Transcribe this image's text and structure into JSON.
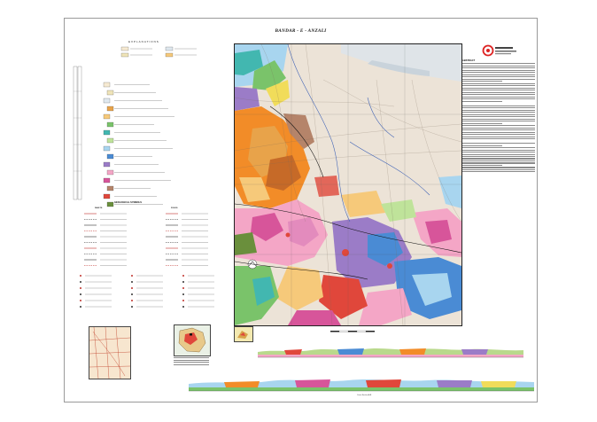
{
  "sheet": {
    "title": "BANDAR - E - ANZALI",
    "top_note": "",
    "explanations_label": "EXPLANATIONS",
    "geological_symbols_label": "GEOLOGICAL SYMBOLS",
    "faults_label": "FAULTS",
    "folds_label": "FOLDS",
    "about_label": "ABSTRACT",
    "cross_section_label": "Cross Section  A-B"
  },
  "colors": {
    "map_base": "#eee6dc",
    "orange": "#f28c28",
    "pink": "#f4a6c6",
    "magenta": "#d7559a",
    "green": "#7ac36a",
    "teal": "#42b7b0",
    "blue": "#4a8bd4",
    "yellow": "#f1dc5a",
    "purple": "#9b7cc7",
    "brown": "#b5846a",
    "red": "#e0473b",
    "lightblue": "#a8d5ef"
  },
  "legend_units": [
    {
      "code": "Qal",
      "color": "#f6ead2"
    },
    {
      "code": "Qt",
      "color": "#efe4b8"
    },
    {
      "code": "Qm",
      "color": "#dfe8ef"
    },
    {
      "code": "Plc",
      "color": "#e8a34a"
    },
    {
      "code": "Ng",
      "color": "#f6c97a"
    },
    {
      "code": "Ev",
      "color": "#7ac36a"
    },
    {
      "code": "Eb",
      "color": "#42b7b0"
    },
    {
      "code": "K",
      "color": "#bfe39a"
    },
    {
      "code": "Kl",
      "color": "#a8d5ef"
    },
    {
      "code": "J",
      "color": "#4a8bd4"
    },
    {
      "code": "Tr",
      "color": "#9b7cc7"
    },
    {
      "code": "P",
      "color": "#f4a6c6"
    },
    {
      "code": "C",
      "color": "#d7559a"
    },
    {
      "code": "D",
      "color": "#b5846a"
    },
    {
      "code": "gr",
      "color": "#e0473b"
    },
    {
      "code": "db",
      "color": "#6a8f3c"
    }
  ]
}
